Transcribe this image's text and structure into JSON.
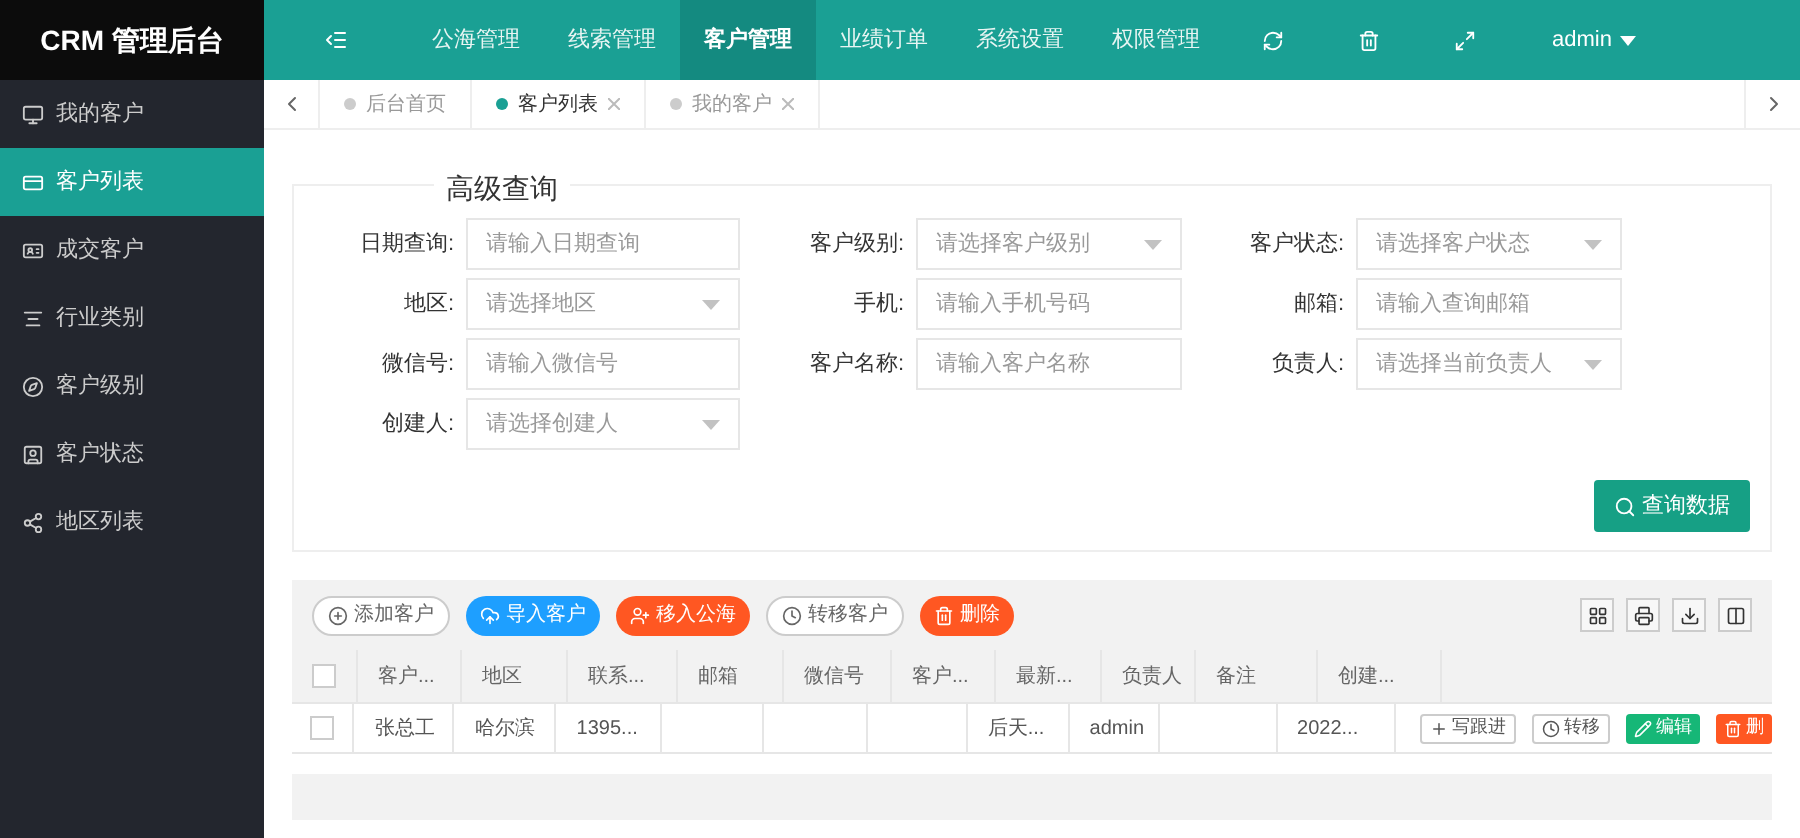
{
  "logo": "CRM 管理后台",
  "top_nav": [
    {
      "label": "公海管理",
      "selected": false
    },
    {
      "label": "线索管理",
      "selected": false
    },
    {
      "label": "客户管理",
      "selected": true
    },
    {
      "label": "业绩订单",
      "selected": false
    },
    {
      "label": "系统设置",
      "selected": false
    },
    {
      "label": "权限管理",
      "selected": false
    }
  ],
  "user": "admin",
  "sidebar": [
    {
      "label": "我的客户",
      "selected": false
    },
    {
      "label": "客户列表",
      "selected": true
    },
    {
      "label": "成交客户",
      "selected": false
    },
    {
      "label": "行业类别",
      "selected": false
    },
    {
      "label": "客户级别",
      "selected": false
    },
    {
      "label": "客户状态",
      "selected": false
    },
    {
      "label": "地区列表",
      "selected": false
    }
  ],
  "page_tabs": [
    {
      "label": "后台首页",
      "selected": false,
      "closable": false
    },
    {
      "label": "客户列表",
      "selected": true,
      "closable": true
    },
    {
      "label": "我的客户",
      "selected": false,
      "closable": true
    }
  ],
  "search_panel": {
    "title": "高级查询",
    "fields": [
      {
        "label": "日期查询:",
        "kind": "input",
        "placeholder": "请输入日期查询"
      },
      {
        "label": "客户级别:",
        "kind": "select",
        "placeholder": "请选择客户级别"
      },
      {
        "label": "客户状态:",
        "kind": "select",
        "placeholder": "请选择客户状态"
      },
      {
        "label": "地区:",
        "kind": "select",
        "placeholder": "请选择地区"
      },
      {
        "label": "手机:",
        "kind": "input",
        "placeholder": "请输入手机号码"
      },
      {
        "label": "邮箱:",
        "kind": "input",
        "placeholder": "请输入查询邮箱"
      },
      {
        "label": "微信号:",
        "kind": "input",
        "placeholder": "请输入微信号"
      },
      {
        "label": "客户名称:",
        "kind": "input",
        "placeholder": "请输入客户名称"
      },
      {
        "label": "负责人:",
        "kind": "select",
        "placeholder": "请选择当前负责人"
      },
      {
        "label": "创建人:",
        "kind": "select",
        "placeholder": "请选择创建人"
      }
    ],
    "search_button": "查询数据"
  },
  "toolbar": [
    {
      "label": "添加客户",
      "kind": "plain"
    },
    {
      "label": "导入客户",
      "kind": "blue"
    },
    {
      "label": "移入公海",
      "kind": "orange"
    },
    {
      "label": "转移客户",
      "kind": "clock"
    },
    {
      "label": "删除",
      "kind": "danger"
    }
  ],
  "table": {
    "all_selected": false,
    "columns": [
      "客户...",
      "地区",
      "联系...",
      "邮箱",
      "微信号",
      "客户...",
      "最新...",
      "负责人",
      "备注",
      "创建..."
    ],
    "rows": [
      {
        "selected": false,
        "cells": [
          "张总工",
          "哈尔滨",
          "1395...",
          "",
          "",
          "",
          "后天...",
          "admin",
          "",
          "2022..."
        ],
        "actions": [
          {
            "label": "写跟进",
            "kind": "follow"
          },
          {
            "label": "转移",
            "kind": "transfer"
          },
          {
            "label": "编辑",
            "kind": "edit"
          },
          {
            "label": "删",
            "kind": "delete"
          }
        ]
      }
    ]
  }
}
